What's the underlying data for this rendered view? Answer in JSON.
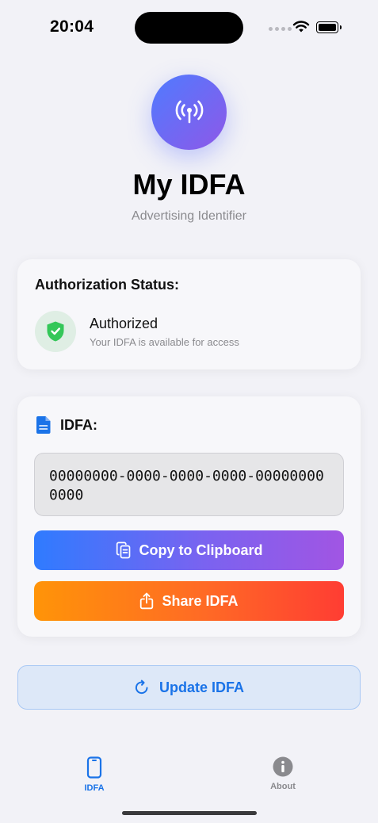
{
  "status_bar": {
    "time": "20:04",
    "icons": [
      "cellular-dots-icon",
      "wifi-icon",
      "battery-icon"
    ]
  },
  "header": {
    "icon": "antenna-signal-icon",
    "title": "My IDFA",
    "subtitle": "Advertising Identifier"
  },
  "authorization": {
    "heading": "Authorization Status:",
    "status": "Authorized",
    "detail": "Your IDFA is available for access",
    "icon": "shield-check-icon"
  },
  "idfa": {
    "heading": "IDFA:",
    "value": "00000000-0000-0000-0000-000000000000",
    "copy_label": "Copy to Clipboard",
    "share_label": "Share IDFA"
  },
  "update_label": "Update IDFA",
  "tabs": [
    {
      "label": "IDFA",
      "icon": "phone-icon",
      "active": true
    },
    {
      "label": "About",
      "icon": "info-icon",
      "active": false
    }
  ],
  "colors": {
    "accent": "#1a73e8",
    "copy_gradient": [
      "#2f7bff",
      "#a155e3"
    ],
    "share_gradient": [
      "#ff9408",
      "#ff3d33"
    ],
    "success": "#34c759",
    "background": "#f2f2f7"
  }
}
